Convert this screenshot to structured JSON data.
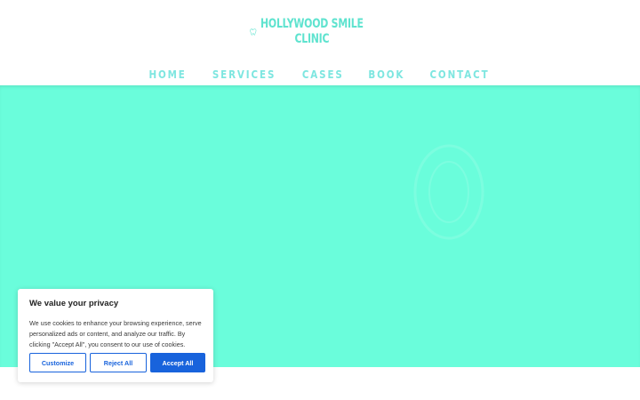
{
  "brand": {
    "line1": "HOLLYWOOD SMILE",
    "line2": "CLINIC",
    "logo_icon": "tooth-icon",
    "color": "#5fe3cf"
  },
  "nav": {
    "items": [
      {
        "label": "HOME"
      },
      {
        "label": "SERVICES"
      },
      {
        "label": "CASES"
      },
      {
        "label": "BOOK"
      },
      {
        "label": "CONTACT"
      }
    ],
    "color": "#7ee6e0"
  },
  "hero": {
    "background": "#6afddb"
  },
  "cookie_banner": {
    "title": "We value your privacy",
    "text": "We use cookies to enhance your browsing experience, serve personalized ads or content, and analyze our traffic. By clicking \"Accept All\", you consent to our use of cookies.",
    "customize_label": "Customize",
    "reject_label": "Reject All",
    "accept_label": "Accept All",
    "accent": "#1863dc"
  }
}
